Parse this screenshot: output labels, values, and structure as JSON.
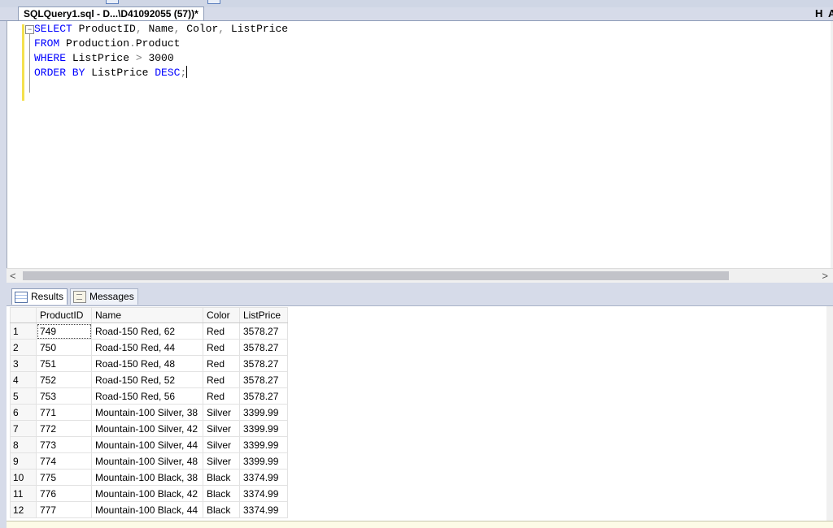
{
  "document_tab": {
    "title": "SQLQuery1.sql - D...\\D41092055 (57))*"
  },
  "top_right_letters": [
    "H",
    "A"
  ],
  "query": {
    "lines": [
      [
        {
          "t": "SELECT",
          "c": "kw"
        },
        {
          "t": " ProductID",
          "c": ""
        },
        {
          "t": ",",
          "c": "op"
        },
        {
          "t": " Name",
          "c": ""
        },
        {
          "t": ",",
          "c": "op"
        },
        {
          "t": " Color",
          "c": ""
        },
        {
          "t": ",",
          "c": "op"
        },
        {
          "t": " ListPrice",
          "c": ""
        }
      ],
      [
        {
          "t": "FROM",
          "c": "kw"
        },
        {
          "t": " Production",
          "c": ""
        },
        {
          "t": ".",
          "c": "op"
        },
        {
          "t": "Product",
          "c": ""
        }
      ],
      [
        {
          "t": "WHERE",
          "c": "kw"
        },
        {
          "t": " ListPrice ",
          "c": ""
        },
        {
          "t": ">",
          "c": "op"
        },
        {
          "t": " 3000",
          "c": ""
        }
      ],
      [
        {
          "t": "ORDER BY",
          "c": "kw"
        },
        {
          "t": " ListPrice ",
          "c": ""
        },
        {
          "t": "DESC",
          "c": "kw"
        },
        {
          "t": ";",
          "c": "op"
        }
      ]
    ]
  },
  "collapse_glyph": "−",
  "scroll_left": "<",
  "scroll_right": ">",
  "results_tabs": {
    "results_label": "Results",
    "messages_label": "Messages"
  },
  "grid": {
    "columns": [
      "",
      "ProductID",
      "Name",
      "Color",
      "ListPrice"
    ],
    "rows": [
      [
        "1",
        "749",
        "Road-150 Red, 62",
        "Red",
        "3578.27"
      ],
      [
        "2",
        "750",
        "Road-150 Red, 44",
        "Red",
        "3578.27"
      ],
      [
        "3",
        "751",
        "Road-150 Red, 48",
        "Red",
        "3578.27"
      ],
      [
        "4",
        "752",
        "Road-150 Red, 52",
        "Red",
        "3578.27"
      ],
      [
        "5",
        "753",
        "Road-150 Red, 56",
        "Red",
        "3578.27"
      ],
      [
        "6",
        "771",
        "Mountain-100 Silver, 38",
        "Silver",
        "3399.99"
      ],
      [
        "7",
        "772",
        "Mountain-100 Silver, 42",
        "Silver",
        "3399.99"
      ],
      [
        "8",
        "773",
        "Mountain-100 Silver, 44",
        "Silver",
        "3399.99"
      ],
      [
        "9",
        "774",
        "Mountain-100 Silver, 48",
        "Silver",
        "3399.99"
      ],
      [
        "10",
        "775",
        "Mountain-100 Black, 38",
        "Black",
        "3374.99"
      ],
      [
        "11",
        "776",
        "Mountain-100 Black, 42",
        "Black",
        "3374.99"
      ],
      [
        "12",
        "777",
        "Mountain-100 Black, 44",
        "Black",
        "3374.99"
      ]
    ]
  },
  "colors": {
    "keyword": "#0000ff",
    "operator": "#808080",
    "change_marker": "#f4e04d"
  }
}
